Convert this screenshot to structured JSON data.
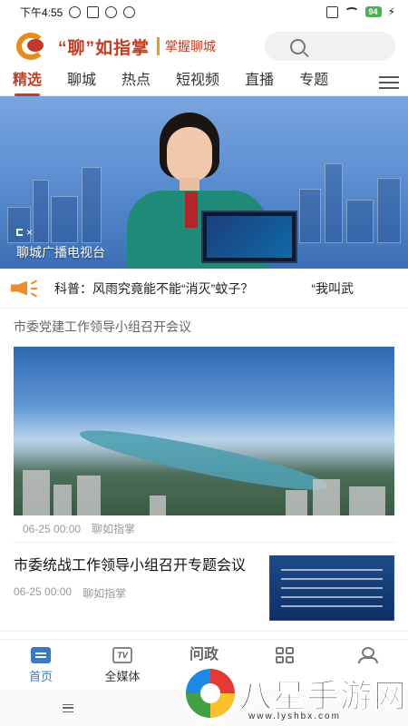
{
  "status_bar": {
    "time": "下午4:55",
    "battery": "94"
  },
  "header": {
    "brand": "“聊”如指掌",
    "slogan": "掌握聊城",
    "search_icon": "search-icon"
  },
  "tabs": [
    {
      "label": "精选",
      "active": true
    },
    {
      "label": "聊城"
    },
    {
      "label": "热点"
    },
    {
      "label": "短视频"
    },
    {
      "label": "直播"
    },
    {
      "label": "专题"
    }
  ],
  "video": {
    "caption": "聊城广播电视台",
    "muted": true
  },
  "ticker": {
    "text": "科普：风雨究竟能不能“消灭”蚊子？",
    "next_text": "“我叫武"
  },
  "articles": [
    {
      "title": "市委党建工作领导小组召开会议",
      "date": "06-25 00:00",
      "source": "聊如指掌"
    },
    {
      "title": "市委统战工作领导小组召开专题会议",
      "date": "06-25 00:00",
      "source": "聊如指掌"
    }
  ],
  "bottom_nav": [
    {
      "label": "首页",
      "icon": "home-icon",
      "active": true
    },
    {
      "label": "全媒体",
      "icon": "tv-icon"
    },
    {
      "label": "问政",
      "icon": "wenzheng-icon"
    },
    {
      "label": "",
      "icon": "grid-icon"
    },
    {
      "label": "",
      "icon": "user-icon"
    }
  ],
  "watermark": {
    "text": "八星手游网",
    "url": "www.lyshbx.com"
  },
  "colors": {
    "brand_red": "#c23b22",
    "accent_orange": "#e88c1a",
    "nav_blue": "#3a78c9"
  }
}
